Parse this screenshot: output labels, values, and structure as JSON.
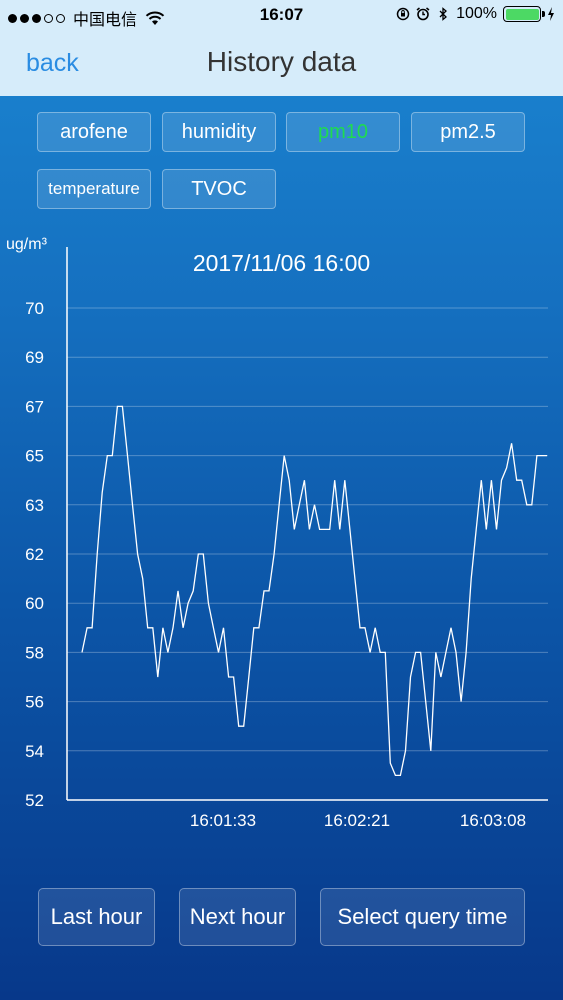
{
  "status_bar": {
    "carrier": "中国电信",
    "time": "16:07",
    "battery_percent": "100%",
    "signal_bars_filled": 3,
    "signal_bars_total": 5
  },
  "nav": {
    "back_label": "back",
    "title": "History data"
  },
  "tabs": [
    {
      "label": "arofene",
      "active": false
    },
    {
      "label": "humidity",
      "active": false
    },
    {
      "label": "pm10",
      "active": true
    },
    {
      "label": "pm2.5",
      "active": false
    },
    {
      "label": "temperature",
      "active": false
    },
    {
      "label": "TVOC",
      "active": false
    }
  ],
  "colors": {
    "active_tab": "#1edc50",
    "nav_link": "#2a8ce2",
    "line": "#ffffff"
  },
  "chart_data": {
    "type": "line",
    "title": "2017/11/06 16:00",
    "ylabel": "ug/m³",
    "yticks": [
      "52",
      "54",
      "56",
      "58",
      "60",
      "62",
      "63",
      "65",
      "67",
      "69",
      "70"
    ],
    "xticks": [
      "16:01:33",
      "16:02:21",
      "16:03:08"
    ],
    "grid": true,
    "series": [
      {
        "values": [
          58,
          59,
          59,
          62,
          63.5,
          65,
          65,
          67,
          67,
          65,
          63,
          62,
          61,
          59,
          59,
          57,
          59,
          58,
          59,
          60.5,
          59,
          60,
          60.5,
          62,
          62,
          60,
          59,
          58,
          59,
          57,
          57,
          55,
          55,
          57,
          59,
          59,
          60.5,
          60.5,
          62,
          63,
          65,
          64,
          62.5,
          63,
          64,
          62.5,
          63,
          62.5,
          62.5,
          62.5,
          64,
          62.5,
          64,
          62.5,
          61,
          59,
          59,
          58,
          59,
          58,
          58,
          53.5,
          53,
          53,
          54,
          57,
          58,
          58,
          56,
          54,
          58,
          57,
          58,
          59,
          58,
          56,
          58,
          61,
          62.5,
          64,
          62.5,
          64,
          62.5,
          64,
          64.5,
          65.5,
          64,
          64,
          63,
          63,
          65,
          65,
          65
        ]
      }
    ]
  },
  "buttons": {
    "last_hour": "Last hour",
    "next_hour": "Next hour",
    "select_query_time": "Select query time"
  }
}
